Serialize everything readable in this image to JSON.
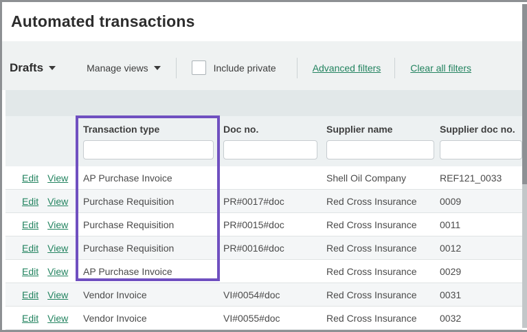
{
  "title": "Automated transactions",
  "toolbar": {
    "view_selector_label": "Drafts",
    "manage_views_label": "Manage views",
    "include_private_label": "Include private",
    "include_private_checked": false,
    "advanced_filters_label": "Advanced filters",
    "clear_all_filters_label": "Clear all filters"
  },
  "table": {
    "edit_label": "Edit",
    "view_label": "View",
    "columns": [
      {
        "label": "Transaction type",
        "filter_value": ""
      },
      {
        "label": "Doc no.",
        "filter_value": ""
      },
      {
        "label": "Supplier name",
        "filter_value": ""
      },
      {
        "label": "Supplier doc no.",
        "filter_value": ""
      }
    ],
    "rows": [
      {
        "transaction_type": "AP Purchase Invoice",
        "doc_no": "",
        "supplier_name": "Shell Oil Company",
        "supplier_doc_no": "REF121_0033"
      },
      {
        "transaction_type": "Purchase Requisition",
        "doc_no": "PR#0017#doc",
        "supplier_name": "Red Cross Insurance",
        "supplier_doc_no": "0009"
      },
      {
        "transaction_type": "Purchase Requisition",
        "doc_no": "PR#0015#doc",
        "supplier_name": "Red Cross Insurance",
        "supplier_doc_no": "0011"
      },
      {
        "transaction_type": "Purchase Requisition",
        "doc_no": "PR#0016#doc",
        "supplier_name": "Red Cross Insurance",
        "supplier_doc_no": "0012"
      },
      {
        "transaction_type": "AP Purchase Invoice",
        "doc_no": "",
        "supplier_name": "Red Cross Insurance",
        "supplier_doc_no": "0029"
      },
      {
        "transaction_type": "Vendor Invoice",
        "doc_no": "VI#0054#doc",
        "supplier_name": "Red Cross Insurance",
        "supplier_doc_no": "0031"
      },
      {
        "transaction_type": "Vendor Invoice",
        "doc_no": "VI#0055#doc",
        "supplier_name": "Red Cross Insurance",
        "supplier_doc_no": "0032"
      }
    ]
  },
  "highlight": {
    "annotated_column": "Transaction type",
    "color": "#7050c0"
  },
  "colors": {
    "link_green": "#22835f",
    "highlight_purple": "#7050c0",
    "toolbar_bg": "#eff2f2",
    "header_band_bg": "#e2e8e9",
    "header_row_bg": "#edf1f2",
    "alt_row_bg": "#f4f6f7"
  }
}
